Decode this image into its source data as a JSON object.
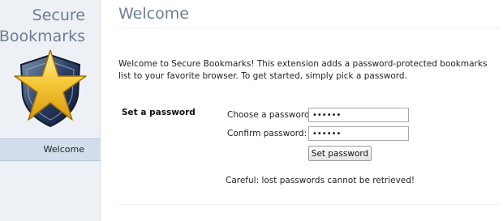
{
  "app": {
    "title_line1": "Secure",
    "title_line2": "Bookmarks",
    "logo_icon": "star-shield-icon",
    "accent_color": "#6d7d93"
  },
  "sidebar": {
    "items": [
      {
        "label": "Welcome",
        "selected": true
      }
    ]
  },
  "main": {
    "title": "Welcome",
    "intro": "Welcome to Secure Bookmarks! This extension adds a password-protected bookmarks list to your favorite browser. To get started, simply pick a password.",
    "section_label": "Set a password",
    "choose_label": "Choose a password:",
    "choose_value": "••••••",
    "confirm_label": "Confirm password:",
    "confirm_value": "••••••",
    "button_label": "Set password",
    "warning": "Careful: lost passwords cannot be retrieved!"
  }
}
